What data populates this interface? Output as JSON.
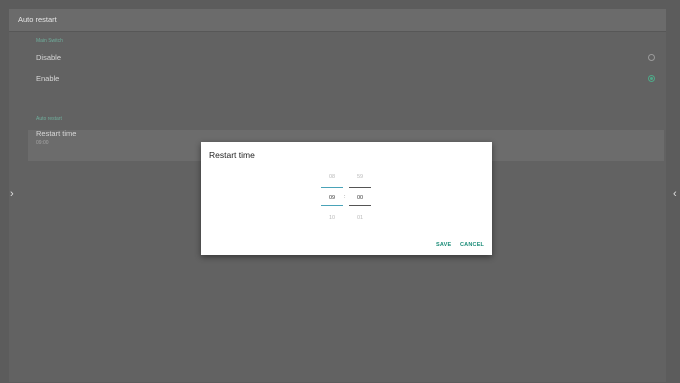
{
  "titlebar": {
    "title": "Auto restart"
  },
  "main_switch": {
    "section_label": "Main Switch",
    "options": [
      {
        "label": "Disable",
        "selected": false
      },
      {
        "label": "Enable",
        "selected": true
      }
    ]
  },
  "auto_restart": {
    "section_label": "Auto restart",
    "restart_time_label": "Restart time",
    "restart_time_value": "09:00"
  },
  "nav": {
    "left_arrow": "›",
    "right_arrow": "‹"
  },
  "dialog": {
    "title": "Restart time",
    "hour": {
      "prev": "08",
      "current": "09",
      "next": "10"
    },
    "minute": {
      "prev": "59",
      "current": "00",
      "next": "01"
    },
    "separator": ":",
    "save_label": "SAVE",
    "cancel_label": "CANCEL"
  },
  "colors": {
    "accent": "#4fa888",
    "button": "#1a8c78",
    "picker_line": "#4aa3b8"
  }
}
